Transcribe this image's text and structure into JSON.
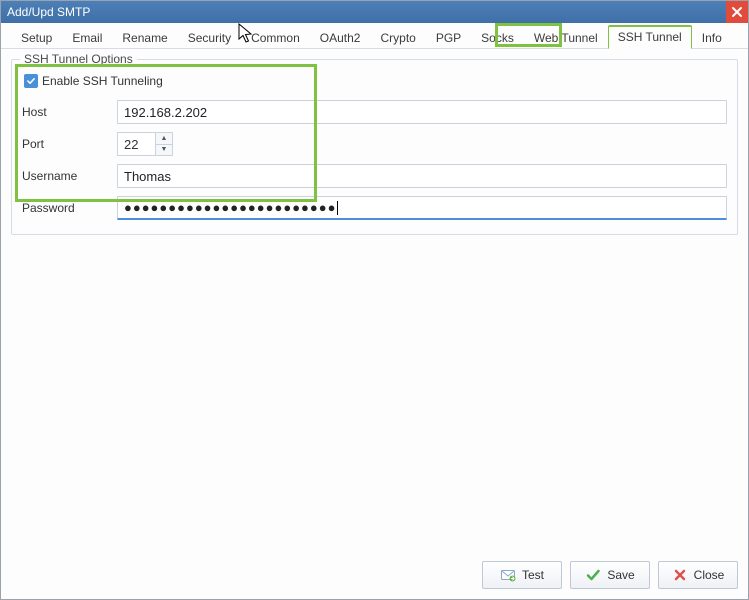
{
  "window": {
    "title": "Add/Upd SMTP"
  },
  "tabs": {
    "items": [
      {
        "label": "Setup"
      },
      {
        "label": "Email"
      },
      {
        "label": "Rename"
      },
      {
        "label": "Security"
      },
      {
        "label": "Common"
      },
      {
        "label": "OAuth2"
      },
      {
        "label": "Crypto"
      },
      {
        "label": "PGP"
      },
      {
        "label": "Socks"
      },
      {
        "label": "Web Tunnel"
      },
      {
        "label": "SSH Tunnel"
      },
      {
        "label": "Info"
      }
    ],
    "active_index": 10
  },
  "group": {
    "title": "SSH Tunnel Options"
  },
  "form": {
    "enable_label": "Enable SSH Tunneling",
    "enable_checked": true,
    "host_label": "Host",
    "host_value": "192.168.2.202",
    "port_label": "Port",
    "port_value": "22",
    "username_label": "Username",
    "username_value": "Thomas",
    "password_label": "Password",
    "password_masked": "●●●●●●●●●●●●●●●●●●●●●●●●"
  },
  "buttons": {
    "test": "Test",
    "save": "Save",
    "close": "Close"
  }
}
